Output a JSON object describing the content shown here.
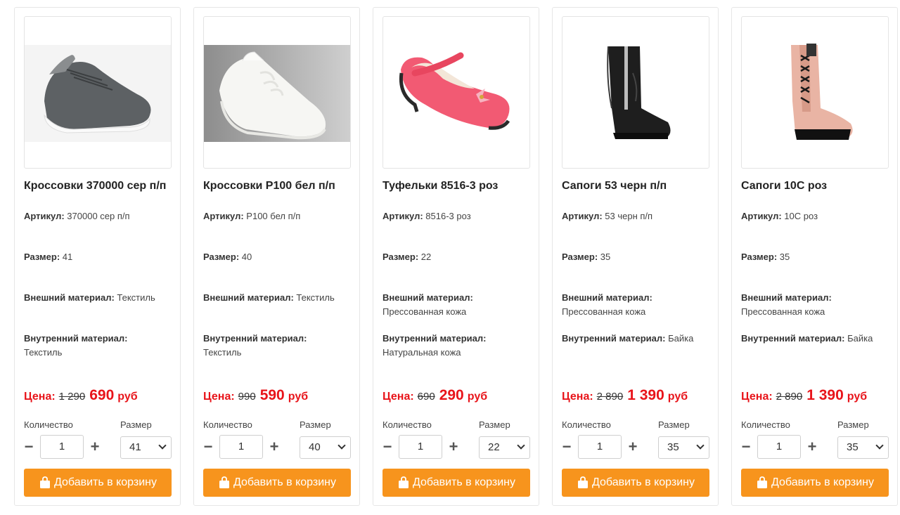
{
  "ui": {
    "spec_labels": {
      "article": "Артикул:",
      "size": "Размер:",
      "outer": "Внешний материал:",
      "inner": "Внутренний материал:"
    },
    "price_label": "Цена:",
    "currency": "руб",
    "qty_label": "Количество",
    "size_label": "Размер",
    "add_to_cart": "Добавить в корзину",
    "minus_glyph": "−",
    "plus_glyph": "+",
    "icons": {
      "bag": "shopping-bag-icon",
      "chevron": "chevron-down-icon"
    },
    "colors": {
      "accent": "#f7941d",
      "price": "#e8141a"
    }
  },
  "products": [
    {
      "title": "Кроссовки 370000 сер п/п",
      "article": "370000 сер п/п",
      "size": "41",
      "outer": "Текстиль",
      "inner": "Текстиль",
      "old_price": "1 290",
      "new_price": "690",
      "qty": "1",
      "selected_size": "41",
      "image": "grey-sneaker"
    },
    {
      "title": "Кроссовки P100 бел п/п",
      "article": "P100 бел п/п",
      "size": "40",
      "outer": "Текстиль",
      "inner": "Текстиль",
      "old_price": "990",
      "new_price": "590",
      "qty": "1",
      "selected_size": "40",
      "image": "white-sneaker"
    },
    {
      "title": "Туфельки 8516-3 роз",
      "article": "8516-3 роз",
      "size": "22",
      "outer": "Прессованная кожа",
      "inner": "Натуральная кожа",
      "old_price": "690",
      "new_price": "290",
      "qty": "1",
      "selected_size": "22",
      "image": "pink-mary-jane"
    },
    {
      "title": "Сапоги 53 черн п/п",
      "article": "53 черн п/п",
      "size": "35",
      "outer": "Прессованная кожа",
      "inner": "Байка",
      "old_price": "2 890",
      "new_price": "1 390",
      "qty": "1",
      "selected_size": "35",
      "image": "black-boot"
    },
    {
      "title": "Сапоги 10С роз",
      "article": "10С роз",
      "size": "35",
      "outer": "Прессованная кожа",
      "inner": "Байка",
      "old_price": "2 890",
      "new_price": "1 390",
      "qty": "1",
      "selected_size": "35",
      "image": "pink-combat-boot"
    }
  ]
}
